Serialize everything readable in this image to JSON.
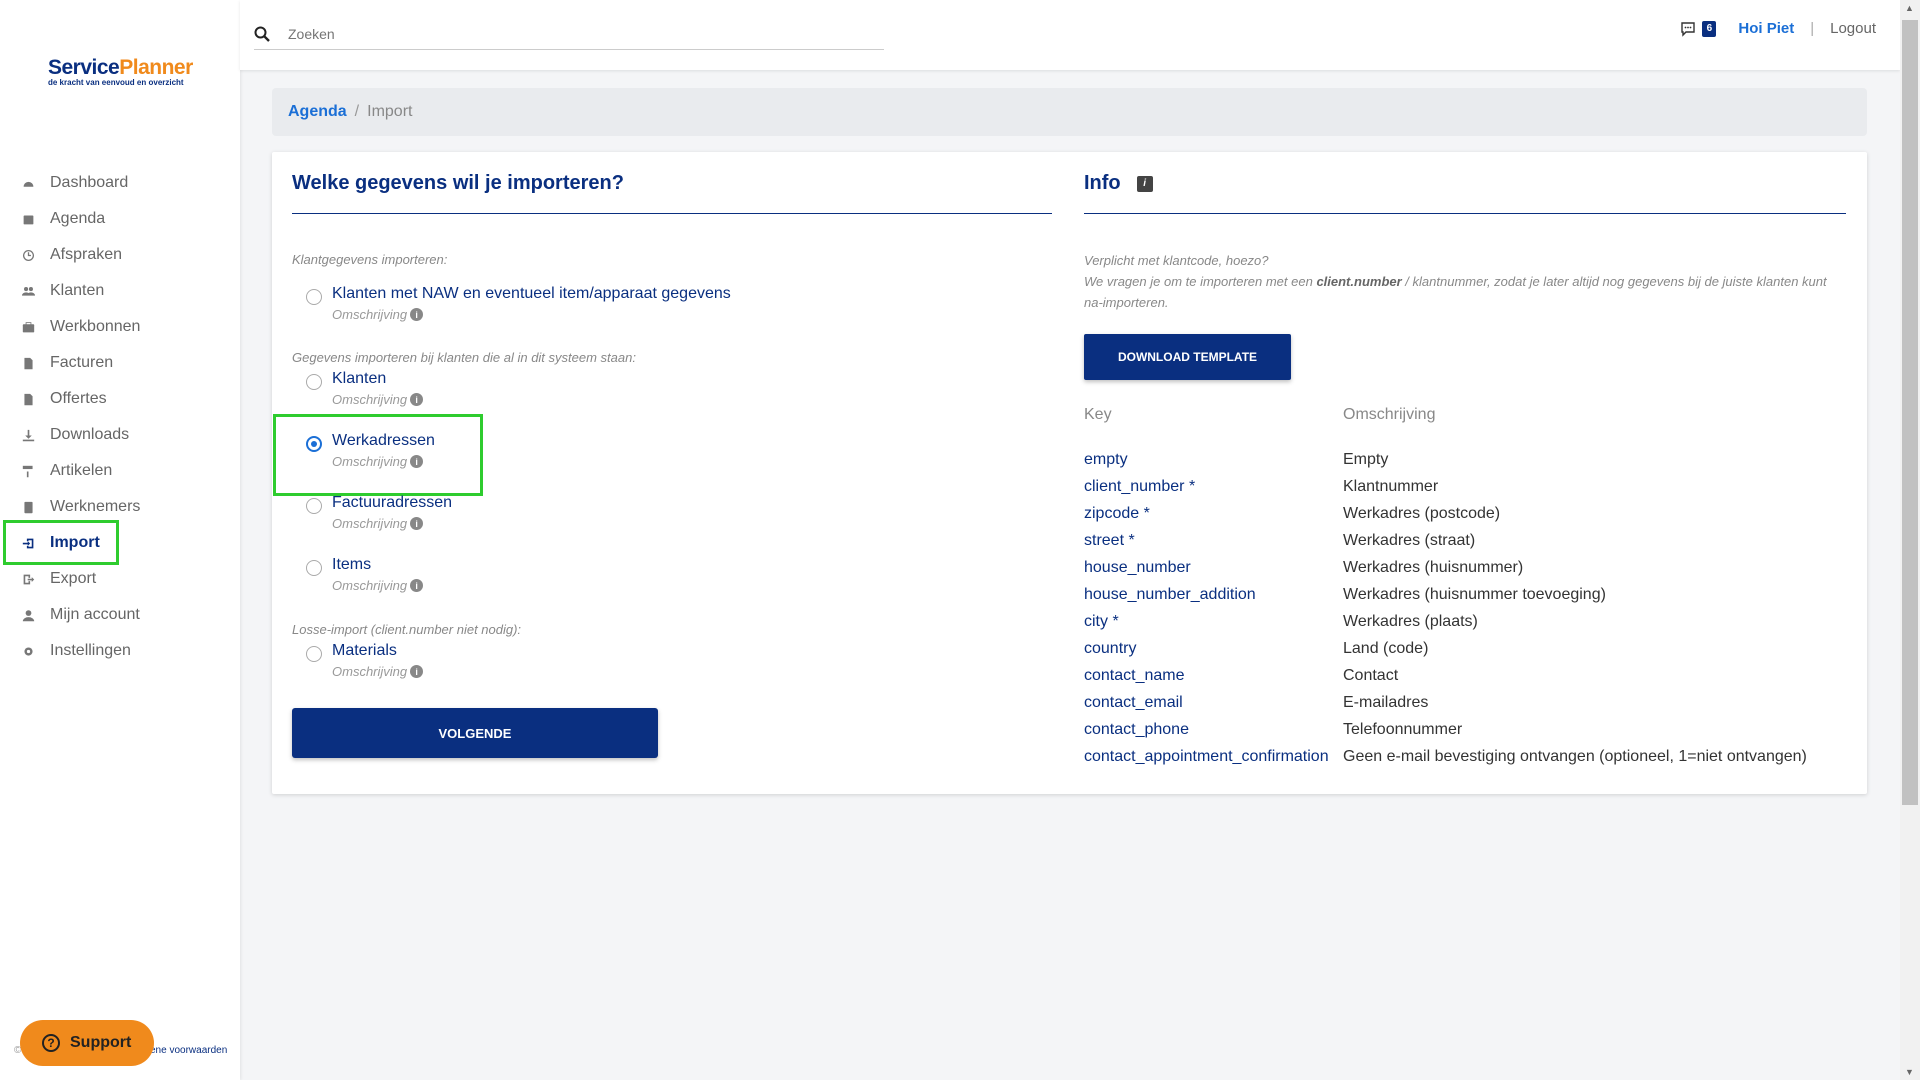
{
  "app": {
    "logo_main_a": "Service",
    "logo_main_b": "Planner",
    "logo_sub": "de kracht van eenvoud en overzicht"
  },
  "sidebar": {
    "items": [
      {
        "label": "Dashboard",
        "icon": "dashboard-icon"
      },
      {
        "label": "Agenda",
        "icon": "calendar-icon"
      },
      {
        "label": "Afspraken",
        "icon": "clock-icon"
      },
      {
        "label": "Klanten",
        "icon": "users-icon"
      },
      {
        "label": "Werkbonnen",
        "icon": "briefcase-icon"
      },
      {
        "label": "Facturen",
        "icon": "file-icon"
      },
      {
        "label": "Offertes",
        "icon": "file-icon"
      },
      {
        "label": "Downloads",
        "icon": "download-icon"
      },
      {
        "label": "Artikelen",
        "icon": "paint-roller-icon"
      },
      {
        "label": "Werknemers",
        "icon": "id-badge-icon"
      },
      {
        "label": "Import",
        "icon": "import-icon"
      },
      {
        "label": "Export",
        "icon": "export-icon"
      },
      {
        "label": "Mijn account",
        "icon": "user-icon"
      },
      {
        "label": "Instellingen",
        "icon": "gear-icon"
      }
    ],
    "active": "Import",
    "support_label": "Support",
    "terms_prefix": "©",
    "terms_label": "ene voorwaarden"
  },
  "topbar": {
    "search_placeholder": "Zoeken",
    "message_count": "6",
    "greeting": "Hoi Piet",
    "separator": "|",
    "logout": "Logout"
  },
  "breadcrumb": {
    "parent": "Agenda",
    "separator": "/",
    "current": "Import"
  },
  "import_form": {
    "title": "Welke gegevens wil je importeren?",
    "groups": [
      {
        "label": "Klantgegevens importeren:"
      },
      {
        "label": "Gegevens importeren bij klanten die al in dit systeem staan:"
      },
      {
        "label": "Losse-import (client.number niet nodig):"
      }
    ],
    "options": [
      {
        "label": "Klanten met NAW en eventueel item/apparaat gegevens",
        "desc": "Omschrijving",
        "checked": false
      },
      {
        "label": "Klanten",
        "desc": "Omschrijving",
        "checked": false
      },
      {
        "label": "Werkadressen",
        "desc": "Omschrijving",
        "checked": true
      },
      {
        "label": "Factuuradressen",
        "desc": "Omschrijving",
        "checked": false
      },
      {
        "label": "Items",
        "desc": "Omschrijving",
        "checked": false
      },
      {
        "label": "Materials",
        "desc": "Omschrijving",
        "checked": false
      }
    ],
    "next_button": "Volgende"
  },
  "info": {
    "title": "Info",
    "line1": "Verplicht met klantcode, hoezo?",
    "line2_pre": "We vragen je om te importeren met een ",
    "line2_bold": "client.number",
    "line2_post": " / klantnummer, zodat je later altijd nog gegevens bij de juiste klanten kunt na-importeren.",
    "download_button": "Download template",
    "table_headers": {
      "key": "Key",
      "desc": "Omschrijving"
    },
    "rows": [
      {
        "key": "empty",
        "desc": "Empty"
      },
      {
        "key": "client_number *",
        "desc": "Klantnummer"
      },
      {
        "key": "zipcode *",
        "desc": "Werkadres (postcode)"
      },
      {
        "key": "street *",
        "desc": "Werkadres (straat)"
      },
      {
        "key": "house_number",
        "desc": "Werkadres (huisnummer)"
      },
      {
        "key": "house_number_addition",
        "desc": "Werkadres (huisnummer toevoeging)"
      },
      {
        "key": "city *",
        "desc": "Werkadres (plaats)"
      },
      {
        "key": "country",
        "desc": "Land (code)"
      },
      {
        "key": "contact_name",
        "desc": "Contact"
      },
      {
        "key": "contact_email",
        "desc": "E-mailadres"
      },
      {
        "key": "contact_phone",
        "desc": "Telefoonnummer"
      },
      {
        "key": "contact_appointment_confirmation",
        "desc": "Geen e-mail bevestiging ontvangen (optioneel, 1=niet ontvangen)"
      }
    ]
  },
  "colors": {
    "brand_navy": "#0a2f80",
    "brand_orange": "#f08a1c",
    "link_blue": "#1b6fd6",
    "highlight_green": "#2ecc2e"
  }
}
